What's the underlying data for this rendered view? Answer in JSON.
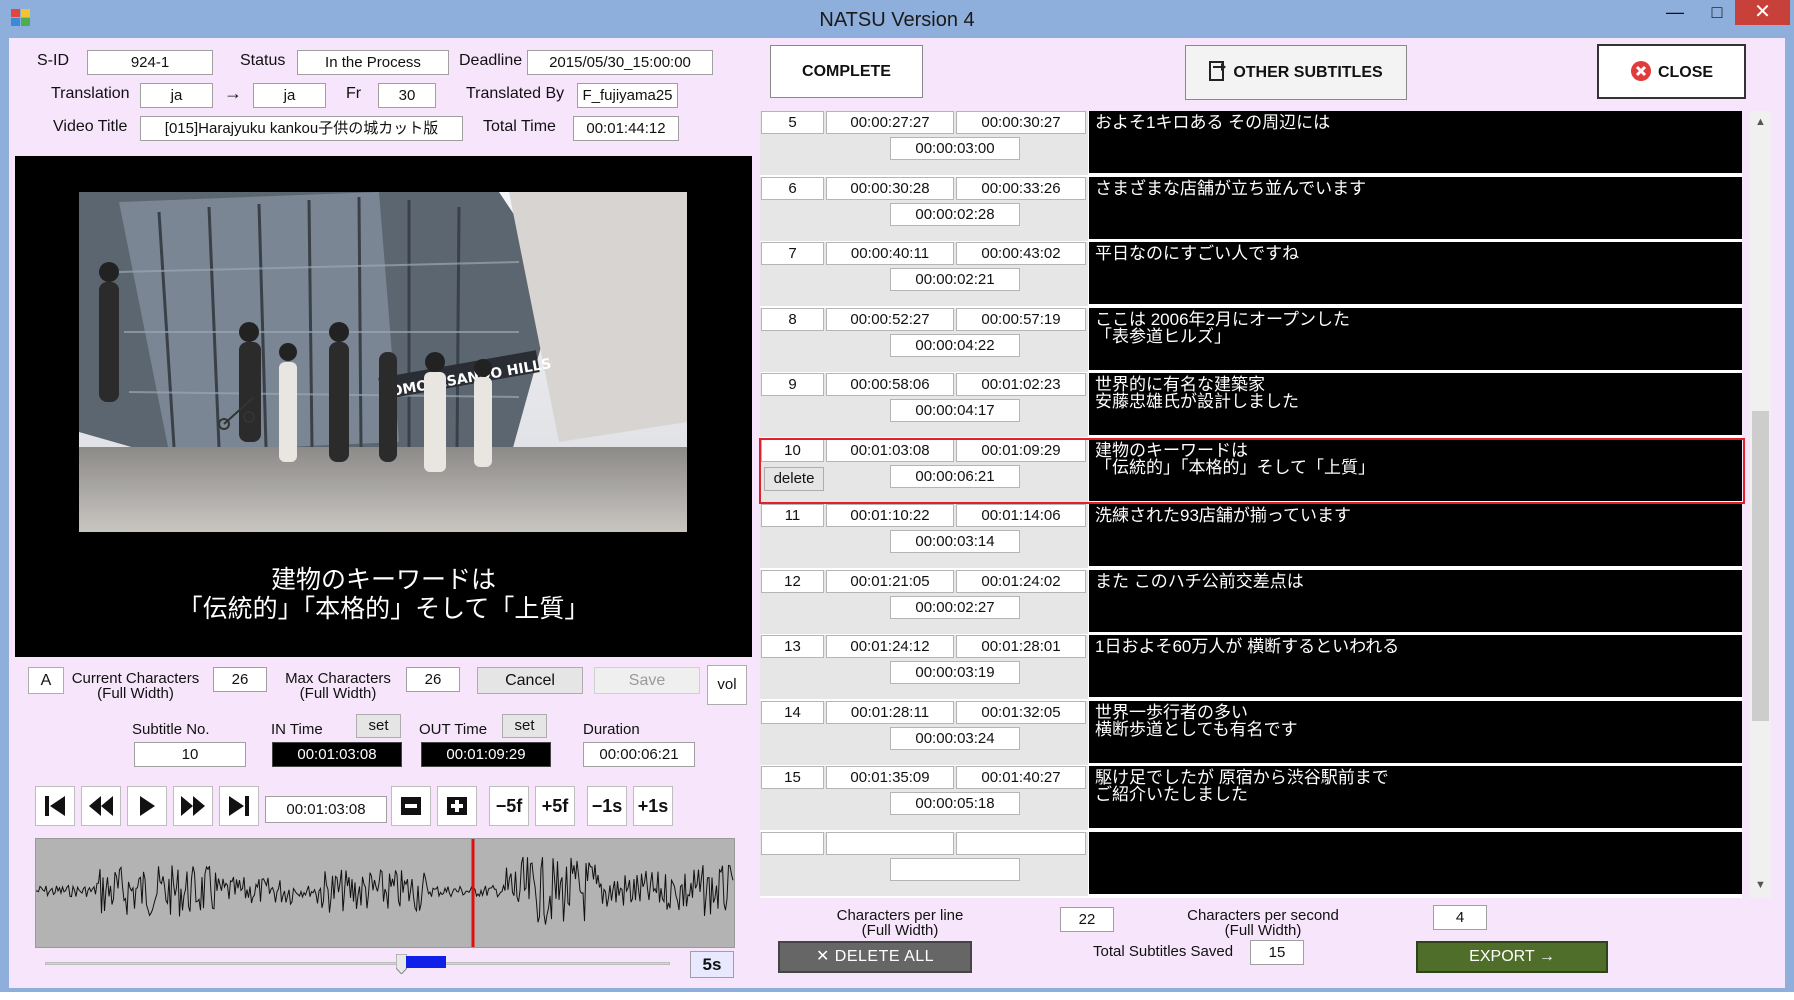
{
  "app": {
    "title": "NATSU Version 4",
    "minimize": "—",
    "maximize": "□",
    "close": "✕"
  },
  "info": {
    "sid_label": "S-ID",
    "sid": "924-1",
    "status_label": "Status",
    "status": "In the Process",
    "deadline_label": "Deadline",
    "deadline": "2015/05/30_15:00:00",
    "translation_label": "Translation",
    "lang_from": "ja",
    "arrow": "→",
    "lang_to": "ja",
    "fr_label": "Fr",
    "fr": "30",
    "translated_by_label": "Translated By",
    "translated_by": "F_fujiyama25",
    "video_title_label": "Video Title",
    "video_title": "[015]Harajyuku kankou子供の城カット版",
    "total_time_label": "Total  Time",
    "total_time": "00:01:44:12"
  },
  "video": {
    "subtitle_line1": "建物のキーワードは",
    "subtitle_line2": "「伝統的」「本格的」そして「上質」",
    "sign_text": "OMOTESANDO HILLS"
  },
  "editor": {
    "font_btn": "A",
    "current_chars_label": "Current Characters",
    "current_chars_sub": "(Full Width)",
    "current_chars": "26",
    "max_chars_label": "Max Characters",
    "max_chars_sub": "(Full Width)",
    "max_chars": "26",
    "cancel": "Cancel",
    "save": "Save",
    "vol": "vol",
    "subtitle_no_label": "Subtitle No.",
    "subtitle_no": "10",
    "in_time_label": "IN Time",
    "in_time": "00:01:03:08",
    "in_set": "set",
    "out_time_label": "OUT Time",
    "out_time": "00:01:09:29",
    "out_set": "set",
    "duration_label": "Duration",
    "duration": "00:00:06:21"
  },
  "transport": {
    "position": "00:01:03:08",
    "minus5f": "−5f",
    "plus5f": "+5f",
    "minus1s": "−1s",
    "plus1s": "+1s",
    "zoom": "5s",
    "slider_position": 0.57
  },
  "top_buttons": {
    "complete": "COMPLETE",
    "other_subtitles": "OTHER SUBTITLES",
    "close": "CLOSE"
  },
  "subtitles": [
    {
      "no": "5",
      "in": "00:00:27:27",
      "out": "00:00:30:27",
      "dur": "00:00:03:00",
      "text": "およそ1キロある その周辺には"
    },
    {
      "no": "6",
      "in": "00:00:30:28",
      "out": "00:00:33:26",
      "dur": "00:00:02:28",
      "text": "さまざまな店舗が立ち並んでいます"
    },
    {
      "no": "7",
      "in": "00:00:40:11",
      "out": "00:00:43:02",
      "dur": "00:00:02:21",
      "text": "平日なのにすごい人ですね"
    },
    {
      "no": "8",
      "in": "00:00:52:27",
      "out": "00:00:57:19",
      "dur": "00:00:04:22",
      "text": "ここは 2006年2月にオープンした\n「表参道ヒルズ」"
    },
    {
      "no": "9",
      "in": "00:00:58:06",
      "out": "00:01:02:23",
      "dur": "00:00:04:17",
      "text": "世界的に有名な建築家\n安藤忠雄氏が設計しました"
    },
    {
      "no": "10",
      "in": "00:01:03:08",
      "out": "00:01:09:29",
      "dur": "00:00:06:21",
      "text": "建物のキーワードは\n「伝統的」「本格的」そして「上質」",
      "selected": true,
      "delete": "delete"
    },
    {
      "no": "11",
      "in": "00:01:10:22",
      "out": "00:01:14:06",
      "dur": "00:00:03:14",
      "text": "洗練された93店舗が揃っています"
    },
    {
      "no": "12",
      "in": "00:01:21:05",
      "out": "00:01:24:02",
      "dur": "00:00:02:27",
      "text": "また このハチ公前交差点は"
    },
    {
      "no": "13",
      "in": "00:01:24:12",
      "out": "00:01:28:01",
      "dur": "00:00:03:19",
      "text": "1日およそ60万人が 横断するといわれる"
    },
    {
      "no": "14",
      "in": "00:01:28:11",
      "out": "00:01:32:05",
      "dur": "00:00:03:24",
      "text": "世界一歩行者の多い\n横断歩道としても有名です"
    },
    {
      "no": "15",
      "in": "00:01:35:09",
      "out": "00:01:40:27",
      "dur": "00:00:05:18",
      "text": "駆け足でしたが 原宿から渋谷駅前まで\nご紹介いたしました"
    },
    {
      "no": "",
      "in": "",
      "out": "",
      "dur": "",
      "text": ""
    }
  ],
  "footer": {
    "cpl_label": "Characters per line",
    "cpl_sub": "(Full Width)",
    "cpl": "22",
    "cps_label": "Characters per second",
    "cps_sub": "(Full Width)",
    "cps": "4",
    "total_label": "Total Subtitles Saved",
    "total": "15",
    "delete_all": "✕ DELETE ALL",
    "export": "EXPORT →"
  }
}
